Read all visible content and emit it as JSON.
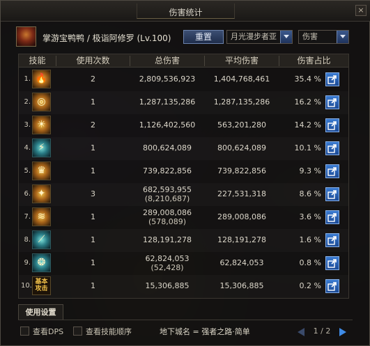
{
  "window": {
    "title": "伤害统计",
    "close_label": "×"
  },
  "character": {
    "name": "掌游宝鸭鸭 / 极诣阿修罗 (Lv.100)"
  },
  "controls": {
    "reset_label": "重置",
    "dungeon_select": "月光漫步者亚",
    "stat_select": "伤害"
  },
  "table": {
    "headers": [
      "技能",
      "使用次数",
      "总伤害",
      "平均伤害",
      "伤害占比"
    ],
    "rows": [
      {
        "rank": "1.",
        "icon": "flame-skill-icon",
        "uses": "2",
        "total": "2,809,536,923",
        "total_sub": "",
        "avg": "1,404,768,461",
        "pct": "35.4 %"
      },
      {
        "rank": "2.",
        "icon": "vortex-skill-icon",
        "uses": "1",
        "total": "1,287,135,286",
        "total_sub": "",
        "avg": "1,287,135,286",
        "pct": "16.2 %"
      },
      {
        "rank": "3.",
        "icon": "sun-skill-icon",
        "uses": "2",
        "total": "1,126,402,560",
        "total_sub": "",
        "avg": "563,201,280",
        "pct": "14.2 %"
      },
      {
        "rank": "4.",
        "icon": "lightning-skill-icon",
        "uses": "1",
        "total": "800,624,089",
        "total_sub": "",
        "avg": "800,624,089",
        "pct": "10.1 %"
      },
      {
        "rank": "5.",
        "icon": "crown-skill-icon",
        "uses": "1",
        "total": "739,822,856",
        "total_sub": "",
        "avg": "739,822,856",
        "pct": "9.3 %"
      },
      {
        "rank": "6.",
        "icon": "burst-skill-icon",
        "uses": "3",
        "total": "682,593,955",
        "total_sub": "(8,210,687)",
        "avg": "227,531,318",
        "pct": "8.6 %"
      },
      {
        "rank": "7.",
        "icon": "wave-skill-icon",
        "uses": "1",
        "total": "289,008,086",
        "total_sub": "(578,089)",
        "avg": "289,008,086",
        "pct": "3.6 %"
      },
      {
        "rank": "8.",
        "icon": "spike-skill-icon",
        "uses": "1",
        "total": "128,191,278",
        "total_sub": "",
        "avg": "128,191,278",
        "pct": "1.6 %"
      },
      {
        "rank": "9.",
        "icon": "orbs-skill-icon",
        "uses": "1",
        "total": "62,824,053",
        "total_sub": "(52,428)",
        "avg": "62,824,053",
        "pct": "0.8 %"
      },
      {
        "rank": "10.",
        "icon": "basic-attack-icon",
        "icon_text": "基本攻击",
        "uses": "1",
        "total": "15,306,885",
        "total_sub": "",
        "avg": "15,306,885",
        "pct": "0.2 %"
      }
    ]
  },
  "footer": {
    "tab_label": "使用设置",
    "check_dps": "查看DPS",
    "check_order": "查看技能顺序",
    "dungeon_label": "地下城名 = 强者之路·简单",
    "page": "1 / 2"
  }
}
